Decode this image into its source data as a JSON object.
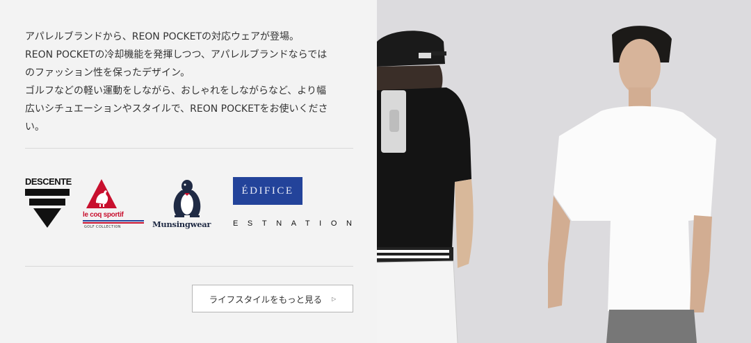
{
  "intro": {
    "line1": "アパレルブランドから、REON POCKETの対応ウェアが登場。",
    "line2": "REON POCKETの冷却機能を発揮しつつ、アパレルブランドならでは",
    "line3": "のファッション性を保ったデザイン。",
    "line4": "ゴルフなどの軽い運動をしながら、おしゃれをしながらなど、より幅",
    "line5": "広いシチュエーションやスタイルで、REON POCKETをお使いくださ",
    "line6": "い。"
  },
  "brands": {
    "descente": "DESCENTE",
    "lecoq": "le coq sportif",
    "lecoq_sub": "GOLF COLLECTION",
    "munsingwear": "Munsingwear",
    "edifice": "ÉDIFICE",
    "estnation": "ESTNATION"
  },
  "cta": {
    "label": "ライフスタイルをもっと見る",
    "icon": "triangle-right-icon"
  },
  "colors": {
    "background": "#f3f3f3",
    "edifice_blue": "#23439a",
    "lecoq_red": "#c8102e",
    "photo_bg": "#dcdbde"
  }
}
